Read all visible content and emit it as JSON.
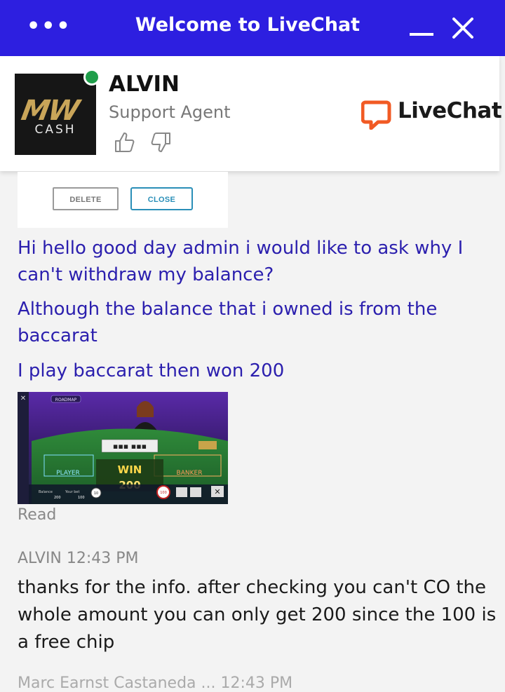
{
  "header": {
    "menu_label": "•••",
    "title": "Welcome to LiveChat"
  },
  "agent": {
    "name": "ALVIN",
    "role": "Support Agent",
    "avatar_logo_text": "MW",
    "avatar_sub_text": "CASH",
    "status": "online",
    "status_color": "#1f9e4a"
  },
  "brand": {
    "name": "LiveChat",
    "accent_color": "#f15a24"
  },
  "form_buttons": {
    "delete_label": "DELETE",
    "close_label": "CLOSE"
  },
  "messages": [
    {
      "text": "Hi hello good day admin i would like to ask why I can't withdraw my balance?"
    },
    {
      "text": "Although the balance that i owned is from the baccarat"
    },
    {
      "text": "I play baccarat then won 200"
    }
  ],
  "game_screenshot": {
    "roadmap_label": "ROADMAP",
    "win_label": "WIN",
    "win_amount": "200",
    "player_label": "PLAYER",
    "banker_label": "BANKER",
    "balance_label": "Balance",
    "your_bet_label": "Your bet",
    "balance_value": "200",
    "bet_value": "100",
    "chip_values": [
      "10",
      "100"
    ]
  },
  "read_receipt": "Read",
  "reply": {
    "sender_time": "ALVIN 12:43 PM",
    "text": "thanks for the info. after checking you can't CO the whole amount you can only get 200 since the 100 is a free chip"
  },
  "next_meta": "Marc Earnst Castaneda ... 12:43 PM",
  "colors": {
    "header_bg": "#2d1fe0",
    "visitor_text": "#2b1fae"
  }
}
